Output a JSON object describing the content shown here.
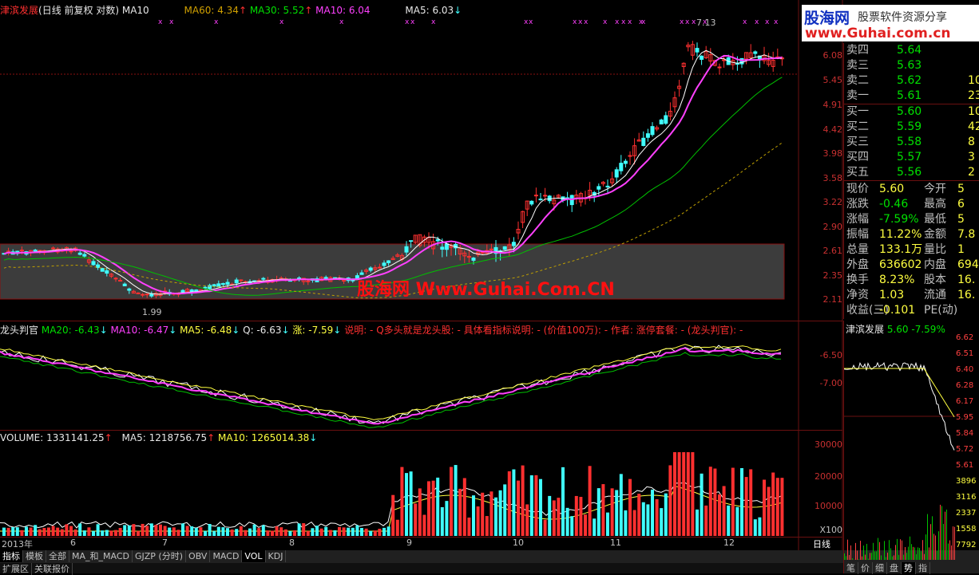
{
  "colors": {
    "up": "#ff3030",
    "down": "#40ffff",
    "ma5": "#ffffff",
    "ma10": "#ff40ff",
    "ma30": "#00c000",
    "ma60": "#c0a000",
    "accent": "#ff3030"
  },
  "main_header": {
    "name": "津滨发展",
    "mode": "(日线 前复权 对数)",
    "ma_label": "MA10",
    "ma60": "MA60: 4.34",
    "ma30": "MA30: 5.52",
    "ma10": "MA10: 6.04",
    "ma5": "MA5: 6.03"
  },
  "price_axis": [
    "6.08",
    "5.45",
    "4.91",
    "4.42",
    "3.98",
    "3.58",
    "3.22",
    "2.90",
    "2.61",
    "2.35",
    "2.11"
  ],
  "annotations": {
    "high": "7.13",
    "low": "1.99"
  },
  "watermark": "股海网 Www.Guhai.Com.CN",
  "logo": {
    "cn": "股海网",
    "slogan": "股票软件资源分享",
    "url": "www.Guhai.com.cn"
  },
  "ind_header": {
    "name": "龙头判官",
    "ma20": "MA20: -6.43",
    "ma10": "MA10: -6.47",
    "ma5": "MA5: -6.48",
    "q": "Q: -6.63",
    "zhang": "涨: -7.59",
    "note": "说明: - Q多头就是龙头股: - 具体看指标说明: - (价值100万): - 作者: 涨停套餐: - (龙头判官): -"
  },
  "ind_axis": [
    "-6.50",
    "-7.00"
  ],
  "vol_header": {
    "volume": "VOLUME: 1331141.25",
    "ma5": "MA5: 1218756.75",
    "ma10": "MA10: 1265014.38"
  },
  "vol_axis": [
    "30000",
    "20000",
    "10000",
    "X100"
  ],
  "date_axis": [
    "2013年",
    "6",
    "7",
    "8",
    "9",
    "10",
    "11",
    "12"
  ],
  "period": "日线",
  "tabs": [
    "指标",
    "模板",
    "全部",
    "MA_和_MACD",
    "GJZP (分时)",
    "OBV",
    "MACD",
    "VOL",
    "KDJ"
  ],
  "bottom_tabs": [
    "扩展区",
    "关联报价"
  ],
  "quote": {
    "sells": [
      {
        "l": "卖四",
        "p": "5.64",
        "v": ""
      },
      {
        "l": "卖三",
        "p": "5.63",
        "v": ""
      },
      {
        "l": "卖二",
        "p": "5.62",
        "v": "10"
      },
      {
        "l": "卖一",
        "p": "5.61",
        "v": "23"
      }
    ],
    "buys": [
      {
        "l": "买一",
        "p": "5.60",
        "v": "10"
      },
      {
        "l": "买二",
        "p": "5.59",
        "v": "42"
      },
      {
        "l": "买三",
        "p": "5.58",
        "v": "8"
      },
      {
        "l": "买四",
        "p": "5.57",
        "v": "3"
      },
      {
        "l": "买五",
        "p": "5.56",
        "v": "2"
      }
    ],
    "stats": [
      {
        "l1": "现价",
        "v1": "5.60",
        "l2": "今开",
        "v2": "5"
      },
      {
        "l1": "涨跌",
        "v1": "-0.46",
        "l2": "最高",
        "v2": "6"
      },
      {
        "l1": "涨幅",
        "v1": "-7.59%",
        "l2": "最低",
        "v2": "5"
      },
      {
        "l1": "振幅",
        "v1": "11.22%",
        "l2": "金额",
        "v2": "7.8"
      },
      {
        "l1": "总量",
        "v1": "133.1万",
        "l2": "量比",
        "v2": "1"
      },
      {
        "l1": "外盘",
        "v1": "636602",
        "l2": "内盘",
        "v2": "694"
      },
      {
        "l1": "换手",
        "v1": "8.23%",
        "l2": "股本",
        "v2": "16."
      },
      {
        "l1": "净资",
        "v1": "1.03",
        "l2": "流通",
        "v2": "16."
      },
      {
        "l1": "收益(三)",
        "v1": "-0.101",
        "l2": "PE(动)",
        "v2": ""
      }
    ]
  },
  "mini": {
    "title": "津滨发展",
    "price": "5.60",
    "chg": "-7.59%",
    "axis": [
      "6.62",
      "6.51",
      "6.40",
      "6.28",
      "6.17",
      "5.95",
      "5.84",
      "5.72",
      "5.61",
      "3896",
      "3116",
      "2337",
      "1558",
      "7792"
    ],
    "tabs": [
      "笔",
      "价",
      "细",
      "盘",
      "势",
      "指"
    ]
  }
}
